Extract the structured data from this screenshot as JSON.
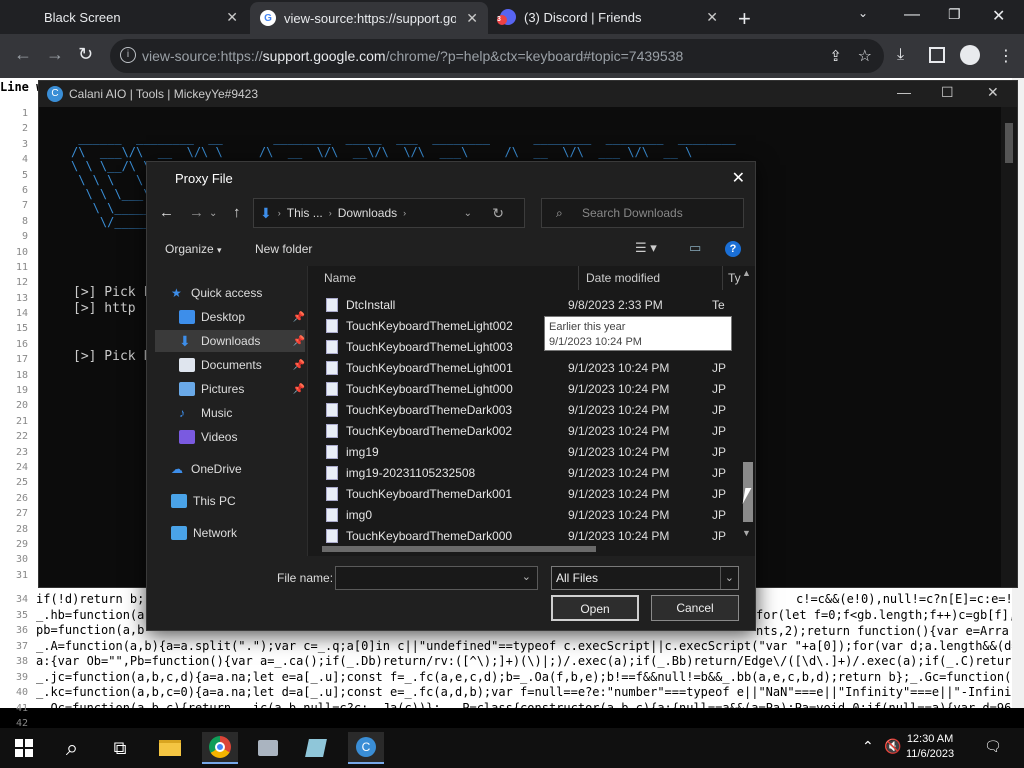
{
  "browser": {
    "tabs": [
      {
        "title": "Black Screen"
      },
      {
        "title": "view-source:https://support.goo"
      },
      {
        "title": "(3) Discord | Friends",
        "badge": "3"
      }
    ],
    "url_prefix": "view-source:https://",
    "url_domain": "support.google.com",
    "url_suffix": "/chrome/?p=help&ctx=keyboard#topic=7439538"
  },
  "view_source": {
    "line_wrap_label": "Line w",
    "gutter_top": [
      "1",
      "2",
      "3",
      "4",
      "5",
      "6",
      "7",
      "8",
      "9",
      "10",
      "11",
      "12",
      "13",
      "14",
      "15",
      "16",
      "17",
      "18",
      "19",
      "20",
      "21",
      "22",
      "23",
      "24",
      "25",
      "26",
      "27",
      "28",
      "29",
      "30",
      "31"
    ],
    "gutter_bottom": [
      "34",
      "35",
      "36",
      "37",
      "38",
      "39",
      "40",
      "41",
      "42"
    ],
    "code_lines": [
      "if(!d)return b;",
      "_.hb=function(a",
      "pb=function(a,b",
      "_.A=function(a,b){a=a.split(\".\");var c=_.q;a[0]in c||\"undefined\"==typeof c.execScript||c.execScript(\"var \"+a[0]);for(var d;a.length&&(d=",
      "a:{var Ob=\"\",Pb=function(){var a=_.ca();if(_.Db)return/rv:([^\\);]+)(\\)|;)/.exec(a);if(_.Bb)return/Edge\\/([\\d\\.]+)/.exec(a);if(_.C)return",
      "_.jc=function(a,b,c,d){a=a.na;let e=a[_.u];const f=_.fc(a,e,c,d);b=_.Oa(f,b,e);b!==f&&null!=b&&_.bb(a,e,c,b,d);return b};_.Gc=function(a,",
      "_.kc=function(a,b,c=0){a=a.na;let d=a[_.u];const e=_.fc(a,d,b);var f=null==e?e:\"number\"===typeof e||\"NaN\"===e||\"Infinity\"===e||\"-Infinit",
      "_.Oc=function(a,b,c){return _.ic(a,b,null=c?c:_.Ja(c))}; _.P=class{constructor(a,b,c){a:{null==a&&(a=Pa);Pa=void 0;if(null==a){var d=96;c"
    ],
    "right_fragments": [
      "c!=c&&(e!0),null!=c?n[E]=c:e=!0;if",
      "for(let f=0;f<gb.length;f++)c=gb[f],O",
      "nts,2);return function(){var e=Arra"
    ]
  },
  "console": {
    "title": "Calani AIO | Tools | MickeyYe#9423",
    "prompts": [
      "[>] Pick Fi",
      "[>] http",
      "[>] Pick P"
    ]
  },
  "dialog": {
    "title": "Proxy File",
    "breadcrumb": [
      "This ...",
      "Downloads"
    ],
    "search_placeholder": "Search Downloads",
    "organize_label": "Organize",
    "new_folder_label": "New folder",
    "nav_items": [
      {
        "label": "Quick access",
        "pinned": false
      },
      {
        "label": "Desktop",
        "pinned": true
      },
      {
        "label": "Downloads",
        "pinned": true,
        "selected": true
      },
      {
        "label": "Documents",
        "pinned": true
      },
      {
        "label": "Pictures",
        "pinned": true
      },
      {
        "label": "Music",
        "pinned": false
      },
      {
        "label": "Videos",
        "pinned": false
      },
      {
        "label": "OneDrive",
        "pinned": false
      },
      {
        "label": "This PC",
        "pinned": false
      },
      {
        "label": "Network",
        "pinned": false
      }
    ],
    "columns": {
      "name": "Name",
      "date": "Date modified",
      "type": "Ty"
    },
    "files": [
      {
        "name": "DtcInstall",
        "date": "9/8/2023 2:33 PM",
        "type": "Te"
      },
      {
        "name": "TouchKeyboardThemeLight002",
        "date": "",
        "type": "JP"
      },
      {
        "name": "TouchKeyboardThemeLight003",
        "date": "",
        "type": "JP"
      },
      {
        "name": "TouchKeyboardThemeLight001",
        "date": "9/1/2023 10:24 PM",
        "type": "JP"
      },
      {
        "name": "TouchKeyboardThemeLight000",
        "date": "9/1/2023 10:24 PM",
        "type": "JP"
      },
      {
        "name": "TouchKeyboardThemeDark003",
        "date": "9/1/2023 10:24 PM",
        "type": "JP"
      },
      {
        "name": "TouchKeyboardThemeDark002",
        "date": "9/1/2023 10:24 PM",
        "type": "JP"
      },
      {
        "name": "img19",
        "date": "9/1/2023 10:24 PM",
        "type": "JP"
      },
      {
        "name": "img19-20231105232508",
        "date": "9/1/2023 10:24 PM",
        "type": "JP"
      },
      {
        "name": "TouchKeyboardThemeDark001",
        "date": "9/1/2023 10:24 PM",
        "type": "JP"
      },
      {
        "name": "img0",
        "date": "9/1/2023 10:24 PM",
        "type": "JP"
      },
      {
        "name": "TouchKeyboardThemeDark000",
        "date": "9/1/2023 10:24 PM",
        "type": "JP"
      }
    ],
    "tooltip": {
      "line1": "Earlier this year",
      "line2": "9/1/2023 10:24 PM"
    },
    "file_name_label": "File name:",
    "file_name_value": "",
    "filter_value": "All Files",
    "open_label": "Open",
    "cancel_label": "Cancel"
  },
  "taskbar": {
    "time": "12:30 AM",
    "date": "11/6/2023"
  }
}
